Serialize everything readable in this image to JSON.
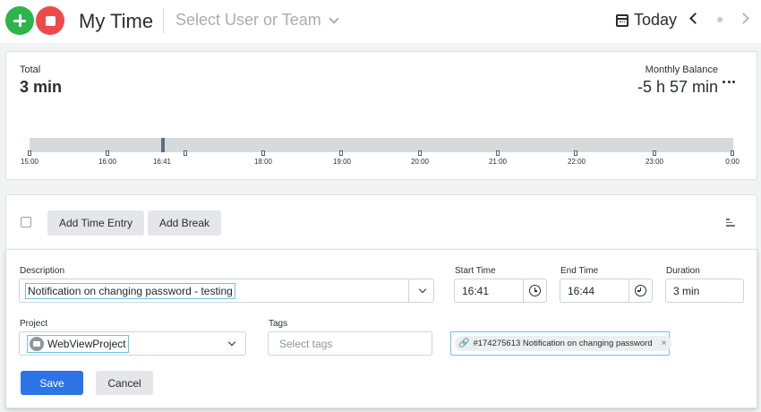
{
  "header": {
    "title": "My Time",
    "user_select_placeholder": "Select User or Team",
    "date_label": "Today",
    "icons": [
      "plus-icon",
      "stop-icon",
      "chevron-down-icon",
      "calendar-icon",
      "chevron-left-icon",
      "dot-icon",
      "chevron-right-icon"
    ]
  },
  "summary": {
    "total_label": "Total",
    "total_value": "3 min",
    "balance_label": "Monthly Balance",
    "balance_value": "-5 h 57 min",
    "timeline_ticks": [
      "15:00",
      "16:00",
      "16:41",
      "18:00",
      "19:00",
      "20:00",
      "21:00",
      "22:00",
      "23:00",
      "0:00"
    ]
  },
  "actions": {
    "add_time_entry": "Add Time Entry",
    "add_break": "Add Break"
  },
  "form": {
    "description_label": "Description",
    "description_value": "Notification on changing password - testing",
    "start_label": "Start Time",
    "start_value": "16:41",
    "end_label": "End Time",
    "end_value": "16:44",
    "duration_label": "Duration",
    "duration_value": "3 min",
    "project_label": "Project",
    "project_value": "WebViewProject",
    "tags_label": "Tags",
    "tags_placeholder": "Select tags",
    "linked_issue": "#174275613 Notification on changing password",
    "chip_close": "×",
    "save": "Save",
    "cancel": "Cancel"
  },
  "colors": {
    "add": "#2bb54a",
    "stop": "#ec4a4a",
    "save": "#2d74e6",
    "highlight": "#6cc4dd",
    "timeline_marker": "#5a6f82"
  }
}
